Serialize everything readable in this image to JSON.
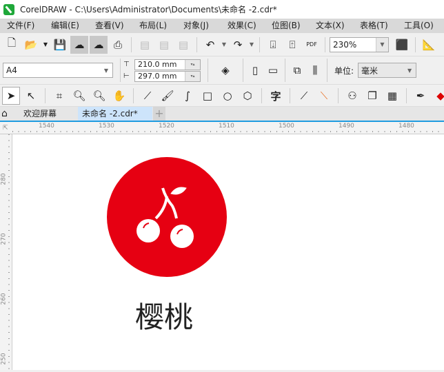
{
  "window": {
    "title": "CorelDRAW - C:\\Users\\Administrator\\Documents\\未命名 -2.cdr*"
  },
  "menu": [
    "文件(F)",
    "编辑(E)",
    "查看(V)",
    "布局(L)",
    "对象(J)",
    "效果(C)",
    "位图(B)",
    "文本(X)",
    "表格(T)",
    "工具(O)"
  ],
  "toolbar": {
    "zoom": "230%",
    "pdf": "PDF"
  },
  "property_bar": {
    "page_size": "A4",
    "width": "210.0 mm",
    "height": "297.0 mm",
    "units_label": "单位:",
    "units": "毫米"
  },
  "toolbox": {
    "text_tool": "字"
  },
  "tabs": {
    "welcome": "欢迎屏幕",
    "document": "未命名 -2.cdr*",
    "add": "+"
  },
  "ruler_top": [
    "1540",
    "1530",
    "1520",
    "1510",
    "1500",
    "1490",
    "1480"
  ],
  "ruler_left": [
    "280",
    "270",
    "260",
    "250"
  ],
  "artwork": {
    "caption": "樱桃",
    "circle_color": "#e60012"
  }
}
